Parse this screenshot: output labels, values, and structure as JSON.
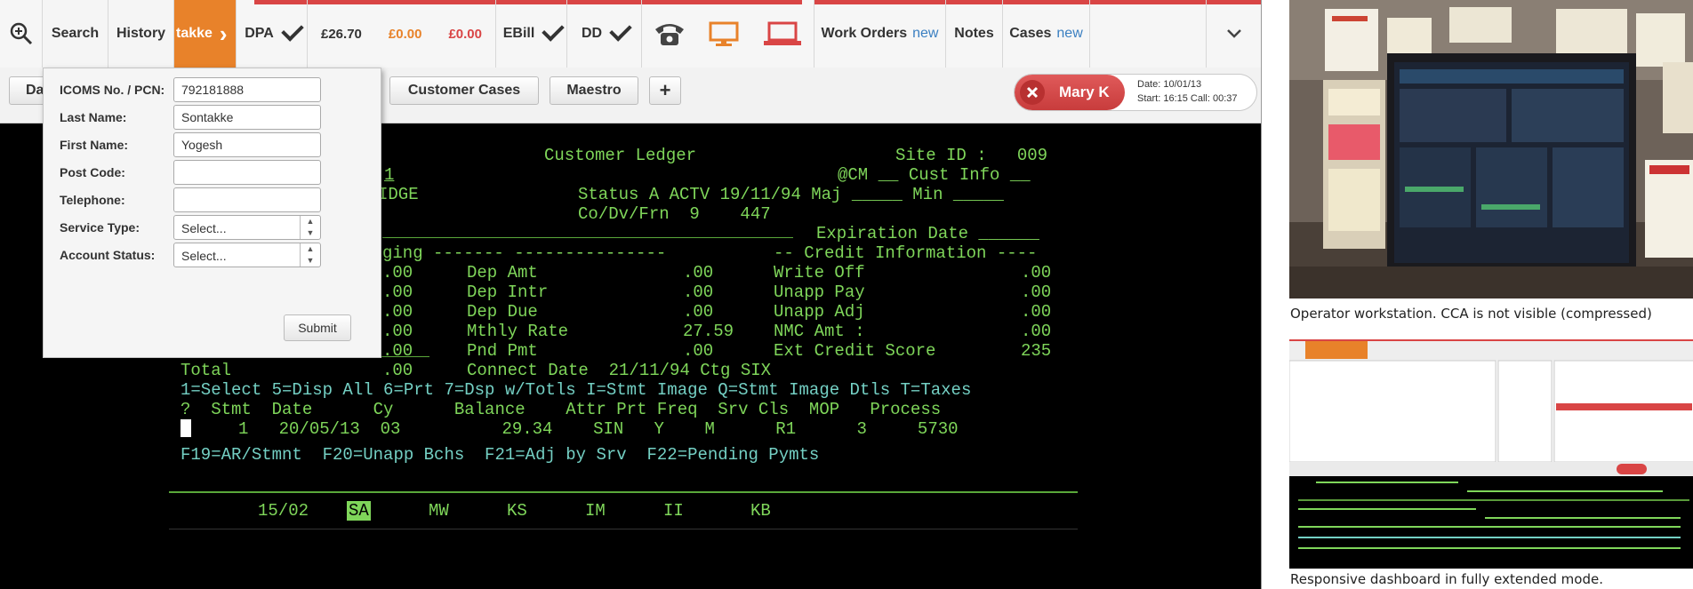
{
  "topbar": {
    "search_label": "Search",
    "history_label": "History",
    "customer_name_fragment": "takke",
    "dpa_label": "DPA",
    "balance_1": "£26.70",
    "balance_2": "£0.00",
    "balance_3": "£0.00",
    "ebill_label": "EBill",
    "dd_label": "DD",
    "work_orders_label": "Work Orders",
    "work_orders_badge": "new",
    "notes_label": "Notes",
    "cases_label": "Cases",
    "cases_badge": "new",
    "colors": {
      "accent_orange": "#e8822a",
      "alert_red": "#d94545",
      "badge_blue": "#3a7fc1"
    }
  },
  "secondary": {
    "dashboard_fragment": "Da",
    "customer_cases_label": "Customer Cases",
    "maestro_label": "Maestro",
    "add_label": "+",
    "agent_name": "Mary K",
    "date_line": "Date: 10/01/13",
    "start_line": "Start: 16:15  Call: 00:37"
  },
  "search_panel": {
    "fields": [
      {
        "label": "ICOMS No. / PCN:",
        "value": "792181888"
      },
      {
        "label": "Last Name:",
        "value": "Sontakke"
      },
      {
        "label": "First Name:",
        "value": "Yogesh"
      },
      {
        "label": "Post Code:",
        "value": ""
      },
      {
        "label": "Telephone:",
        "value": ""
      }
    ],
    "selects": [
      {
        "label": "Service Type:",
        "value": "Select..."
      },
      {
        "label": "Account Status:",
        "value": "Select..."
      }
    ],
    "submit_label": "Submit"
  },
  "terminal": {
    "title": "Customer Ledger",
    "site": "Site ID :   009",
    "l1_left": "1",
    "l1_right": "@CM __ Cust Info __",
    "l2_left": "IDGE",
    "l2_right": "Status A ACTV 19/11/94 Maj _____ Min _____",
    "l3": "Co/Dv/Frn  9    447",
    "expiration": "Expiration Date ______",
    "aging_header": "ging ------- ---------------",
    "credit_header": "-- Credit Information ----",
    "rows": [
      {
        "a": ".00",
        "b": "Dep Amt",
        "c": ".00",
        "d": "Write Off",
        "e": ".00"
      },
      {
        "a": ".00",
        "b": "Dep Intr",
        "c": ".00",
        "d": "Unapp Pay",
        "e": ".00"
      },
      {
        "a": ".00",
        "b": "Dep Due",
        "c": ".00",
        "d": "Unapp Adj",
        "e": ".00"
      },
      {
        "a": ".00",
        "b": "Mthly Rate",
        "c": "27.59",
        "d": "NMC Amt :",
        "e": ".00"
      },
      {
        "a": ".00",
        "b": "Pnd Pmt",
        "c": ".00",
        "d": "Ext Credit Score",
        "e": "235"
      }
    ],
    "total_label": "Total",
    "total_value": ".00",
    "connect": "Connect Date  21/11/94 Ctg SIX",
    "commands": "1=Select 5=Disp All 6=Prt 7=Dsp w/Totls I=Stmt Image Q=Stmt Image Dtls T=Taxes",
    "col_header": "?  Stmt  Date      Cy      Balance    Attr Prt Freq  Srv Cls  MOP   Process",
    "row_values": "1   20/05/13  03          29.34    SIN   Y    M      R1      3     5730",
    "fkeys": "F19=AR/Stmnt  F20=Unapp Bchs  F21=Adj by Srv  F22=Pending Pymts",
    "bottom_items": [
      "15/02",
      "SA",
      "MW",
      "KS",
      "IM",
      "II",
      "KB"
    ]
  },
  "right_panel": {
    "caption_1": "Operator workstation. CCA is not visible (compressed)",
    "caption_2": "Responsive dashboard in fully extended mode."
  }
}
